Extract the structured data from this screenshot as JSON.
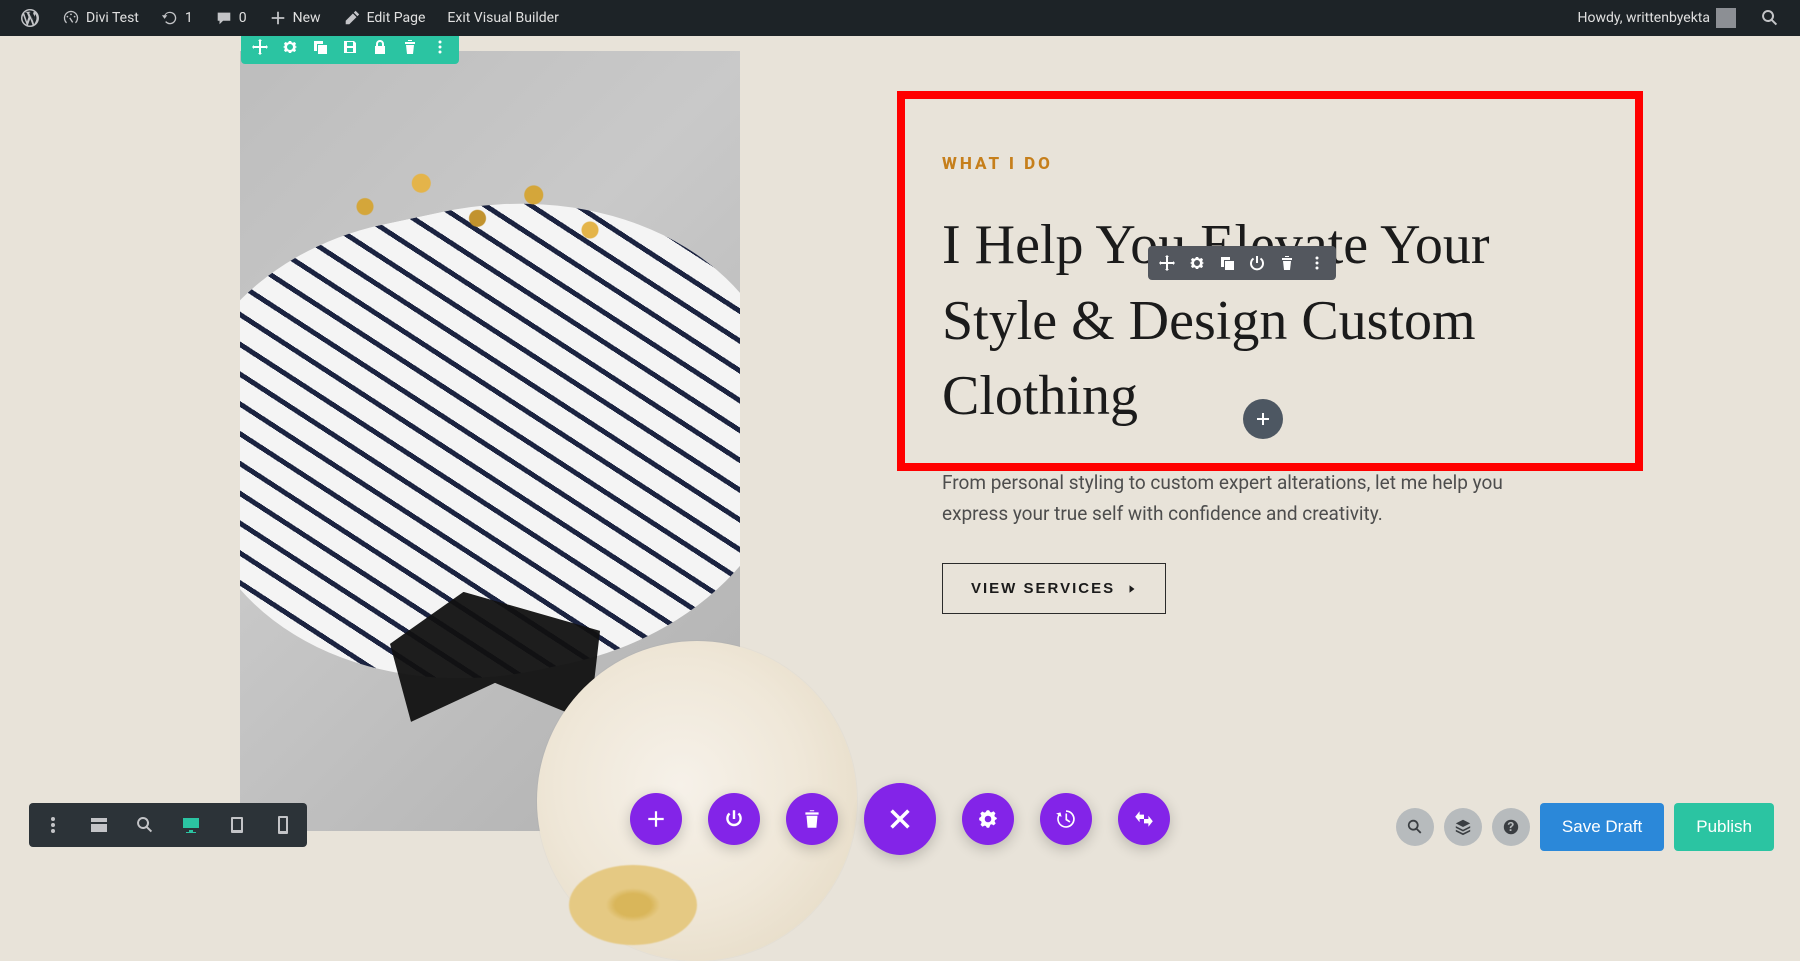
{
  "adminbar": {
    "site_name": "Divi Test",
    "updates_count": "1",
    "comments_count": "0",
    "new_label": "New",
    "edit_page_label": "Edit Page",
    "exit_vb_label": "Exit Visual Builder",
    "howdy_text": "Howdy, writtenbyekta"
  },
  "content": {
    "eyebrow": "WHAT I DO",
    "headline": "I Help You Elevate Your Style & Design Custom Clothing",
    "body": "From personal styling  to custom expert alterations, let me help you express your true self with confidence and creativity.",
    "cta_label": "VIEW SERVICES"
  },
  "bottom_right": {
    "save_draft": "Save Draft",
    "publish": "Publish"
  }
}
